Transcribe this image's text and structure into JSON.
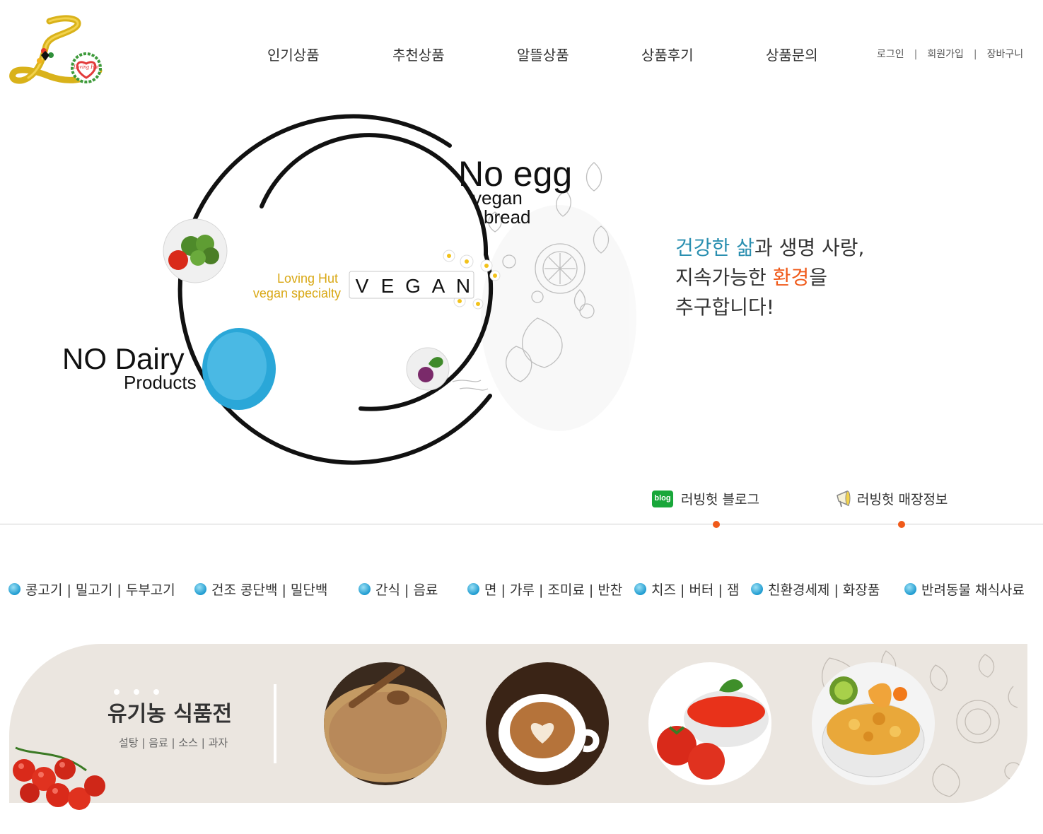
{
  "header": {
    "logo_text": "Loving Hut",
    "nav": [
      "인기상품",
      "추천상품",
      "알뜰상품",
      "상품후기",
      "상품문의"
    ],
    "util": {
      "login": "로그인",
      "sep": "|",
      "join": "회원가입",
      "cart": "장바구니"
    }
  },
  "hero": {
    "no_egg": "No egg",
    "vegan": "vegan",
    "bread": "bread",
    "no_dairy": "NO Dairy",
    "products": "Products",
    "brand_line1": "Loving Hut",
    "brand_line2": "vegan specialty",
    "vegan_tiles": [
      "V",
      "E",
      "G",
      "A",
      "N"
    ],
    "slogan": {
      "line1_blue": "건강한 삶",
      "line1_rest": "과 생명 사랑,",
      "line2_start": "지속가능한 ",
      "line2_orange": "환경",
      "line2_end": "을",
      "line3": "추구합니다!"
    }
  },
  "quick_links": {
    "blog_badge": "blog",
    "blog": "러빙헛 블로그",
    "store": "러빙헛 매장정보"
  },
  "categories": [
    "콩고기 | 밀고기 | 두부고기",
    "건조 콩단백 | 밀단백",
    "간식 | 음료",
    "면 | 가루 | 조미료 |  반찬",
    "치즈 | 버터 | 잼",
    "친환경세제 | 화장품",
    "반려동물 채식사료"
  ],
  "banner": {
    "title": "유기농 식품전",
    "subtitle": "설탕 | 음료 | 소스 | 과자",
    "items": [
      "sugar-image",
      "coffee-image",
      "sauce-image",
      "cereal-image"
    ]
  },
  "colors": {
    "accent_blue": "#2a8fb0",
    "accent_orange": "#f05a1a",
    "banner_bg": "#ebe6e0"
  }
}
